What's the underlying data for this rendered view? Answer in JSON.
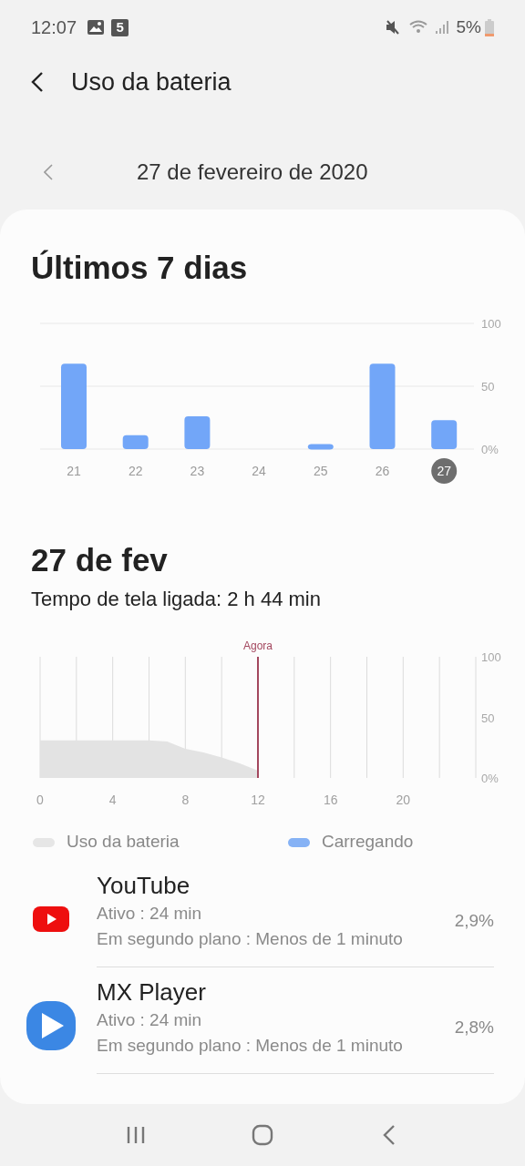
{
  "status_bar": {
    "time": "12:07",
    "notification_badge": "5",
    "battery": "5%"
  },
  "header": {
    "title": "Uso da bateria"
  },
  "date_nav": {
    "date": "27 de fevereiro de 2020"
  },
  "week": {
    "title": "Últimos 7 dias",
    "selected": [
      false,
      false,
      false,
      false,
      false,
      false,
      true
    ],
    "chart_data": {
      "type": "bar",
      "categories": [
        "21",
        "22",
        "23",
        "24",
        "25",
        "26",
        "27"
      ],
      "series": [
        {
          "color": "#72a6f8",
          "values": [
            68,
            11,
            26,
            0,
            4,
            68,
            23
          ]
        }
      ],
      "grid": true,
      "ylim": [
        0,
        100
      ],
      "yticks": [
        {
          "value": 0,
          "label": "0%"
        },
        {
          "value": 50,
          "label": "50"
        },
        {
          "value": 100,
          "label": "100"
        }
      ]
    }
  },
  "day": {
    "title": "27 de fev",
    "screen_time": "Tempo de tela ligada: 2 h 44 min",
    "chart_data": {
      "type": "area",
      "x": [
        0,
        1,
        2,
        3,
        4,
        5,
        6,
        7,
        8,
        9,
        10,
        11,
        12
      ],
      "series": [
        {
          "color": "#e3e3e3",
          "values": [
            31,
            31,
            31,
            31,
            31,
            31,
            31,
            30,
            24,
            21,
            17,
            12,
            6
          ]
        }
      ],
      "grid": true,
      "xlim": [
        0,
        24
      ],
      "ylim": [
        0,
        100
      ],
      "xticks": [
        0,
        4,
        8,
        12,
        16,
        20
      ],
      "yticks": [
        {
          "value": 0,
          "label": "0%"
        },
        {
          "value": 50,
          "label": "50"
        },
        {
          "value": 100,
          "label": "100"
        }
      ],
      "ref_lines": [
        {
          "axis": "x",
          "value": 12,
          "color": "#a3475e"
        }
      ],
      "annotations": [
        "Agora"
      ]
    }
  },
  "legend": [
    {
      "label": "Uso da bateria",
      "color": "#e6e6e6"
    },
    {
      "label": "Carregando",
      "color": "#86b2f5"
    }
  ],
  "apps": [
    {
      "kind": "youtube",
      "name": "YouTube",
      "active": "Ativo : 24 min",
      "background": "Em segundo plano : Menos de 1 minuto",
      "percent": "2,9%"
    },
    {
      "kind": "mxplayer",
      "name": "MX Player",
      "active": "Ativo : 24 min",
      "background": "Em segundo plano : Menos de 1 minuto",
      "percent": "2,8%"
    }
  ]
}
